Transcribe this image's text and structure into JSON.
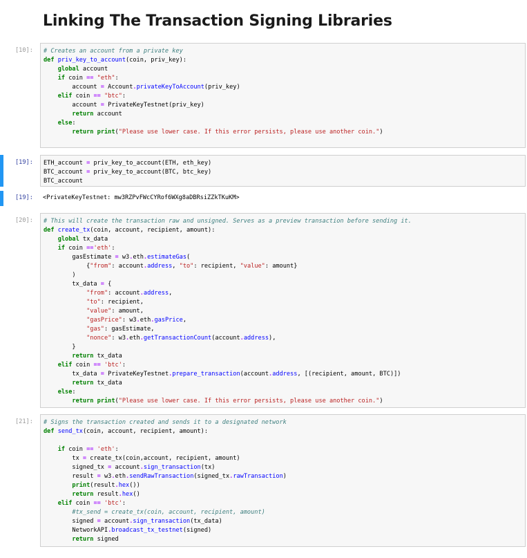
{
  "notebook": {
    "heading": "Linking The Transaction Signing Libraries",
    "cells": [
      {
        "prompt": "[10]:",
        "lines": [
          [
            [
              "c",
              "# Creates an account from a private key"
            ]
          ],
          [
            [
              "k",
              "def"
            ],
            [
              "n",
              " "
            ],
            [
              "f",
              "priv_key_to_account"
            ],
            [
              "n",
              "(coin, priv_key):"
            ]
          ],
          [
            [
              "n",
              "    "
            ],
            [
              "k",
              "global"
            ],
            [
              "n",
              " account"
            ]
          ],
          [
            [
              "n",
              "    "
            ],
            [
              "k",
              "if"
            ],
            [
              "n",
              " coin "
            ],
            [
              "o",
              "=="
            ],
            [
              "n",
              " "
            ],
            [
              "s",
              "\"eth\""
            ],
            [
              "n",
              ":"
            ]
          ],
          [
            [
              "n",
              "        account "
            ],
            [
              "o",
              "="
            ],
            [
              "n",
              " Account"
            ],
            [
              "o",
              "."
            ],
            [
              "f",
              "privateKeyToAccount"
            ],
            [
              "n",
              "(priv_key)"
            ]
          ],
          [
            [
              "n",
              "    "
            ],
            [
              "k",
              "elif"
            ],
            [
              "n",
              " coin "
            ],
            [
              "o",
              "=="
            ],
            [
              "n",
              " "
            ],
            [
              "s",
              "\"btc\""
            ],
            [
              "n",
              ":"
            ]
          ],
          [
            [
              "n",
              "        account "
            ],
            [
              "o",
              "="
            ],
            [
              "n",
              " PrivateKeyTestnet(priv_key)"
            ]
          ],
          [
            [
              "n",
              "        "
            ],
            [
              "k",
              "return"
            ],
            [
              "n",
              " account"
            ]
          ],
          [
            [
              "n",
              "    "
            ],
            [
              "k",
              "else"
            ],
            [
              "n",
              ":"
            ]
          ],
          [
            [
              "n",
              "        "
            ],
            [
              "k",
              "return"
            ],
            [
              "n",
              " "
            ],
            [
              "k",
              "print"
            ],
            [
              "n",
              "("
            ],
            [
              "s",
              "\"Please use lower case. If this error persists, please use another coin.\""
            ],
            [
              "n",
              ")"
            ]
          ],
          [
            [
              "n",
              " "
            ]
          ]
        ]
      },
      {
        "prompt": "[19]:",
        "lines": [
          [
            [
              "n",
              "ETH_account "
            ],
            [
              "o",
              "="
            ],
            [
              "n",
              " priv_key_to_account(ETH, eth_key)"
            ]
          ],
          [
            [
              "n",
              "BTC_account "
            ],
            [
              "o",
              "="
            ],
            [
              "n",
              " priv_key_to_account(BTC, btc_key)"
            ]
          ],
          [
            [
              "n",
              "BTC_account"
            ]
          ]
        ]
      },
      {
        "prompt": "[20]:",
        "lines": [
          [
            [
              "c",
              "# This will create the transaction raw and unsigned. Serves as a preview transaction before sending it."
            ]
          ],
          [
            [
              "k",
              "def"
            ],
            [
              "n",
              " "
            ],
            [
              "f",
              "create_tx"
            ],
            [
              "n",
              "(coin, account, recipient, amount):"
            ]
          ],
          [
            [
              "n",
              "    "
            ],
            [
              "k",
              "global"
            ],
            [
              "n",
              " tx_data"
            ]
          ],
          [
            [
              "n",
              "    "
            ],
            [
              "k",
              "if"
            ],
            [
              "n",
              " coin "
            ],
            [
              "o",
              "=="
            ],
            [
              "s",
              "'eth'"
            ],
            [
              "n",
              ":"
            ]
          ],
          [
            [
              "n",
              "        gasEstimate "
            ],
            [
              "o",
              "="
            ],
            [
              "n",
              " w3"
            ],
            [
              "o",
              "."
            ],
            [
              "n",
              "eth"
            ],
            [
              "o",
              "."
            ],
            [
              "f",
              "estimateGas"
            ],
            [
              "n",
              "("
            ]
          ],
          [
            [
              "n",
              "            {"
            ],
            [
              "s",
              "\"from\""
            ],
            [
              "n",
              ": account"
            ],
            [
              "o",
              "."
            ],
            [
              "f",
              "address"
            ],
            [
              "n",
              ", "
            ],
            [
              "s",
              "\"to\""
            ],
            [
              "n",
              ": recipient, "
            ],
            [
              "s",
              "\"value\""
            ],
            [
              "n",
              ": amount}"
            ]
          ],
          [
            [
              "n",
              "        )"
            ]
          ],
          [
            [
              "n",
              "        tx_data "
            ],
            [
              "o",
              "="
            ],
            [
              "n",
              " {"
            ]
          ],
          [
            [
              "n",
              "            "
            ],
            [
              "s",
              "\"from\""
            ],
            [
              "n",
              ": account"
            ],
            [
              "o",
              "."
            ],
            [
              "f",
              "address"
            ],
            [
              "n",
              ","
            ]
          ],
          [
            [
              "n",
              "            "
            ],
            [
              "s",
              "\"to\""
            ],
            [
              "n",
              ": recipient,"
            ]
          ],
          [
            [
              "n",
              "            "
            ],
            [
              "s",
              "\"value\""
            ],
            [
              "n",
              ": amount,"
            ]
          ],
          [
            [
              "n",
              "            "
            ],
            [
              "s",
              "\"gasPrice\""
            ],
            [
              "n",
              ": w3"
            ],
            [
              "o",
              "."
            ],
            [
              "n",
              "eth"
            ],
            [
              "o",
              "."
            ],
            [
              "f",
              "gasPrice"
            ],
            [
              "n",
              ","
            ]
          ],
          [
            [
              "n",
              "            "
            ],
            [
              "s",
              "\"gas\""
            ],
            [
              "n",
              ": gasEstimate,"
            ]
          ],
          [
            [
              "n",
              "            "
            ],
            [
              "s",
              "\"nonce\""
            ],
            [
              "n",
              ": w3"
            ],
            [
              "o",
              "."
            ],
            [
              "n",
              "eth"
            ],
            [
              "o",
              "."
            ],
            [
              "f",
              "getTransactionCount"
            ],
            [
              "n",
              "(account"
            ],
            [
              "o",
              "."
            ],
            [
              "f",
              "address"
            ],
            [
              "n",
              "),"
            ]
          ],
          [
            [
              "n",
              "        }"
            ]
          ],
          [
            [
              "n",
              "        "
            ],
            [
              "k",
              "return"
            ],
            [
              "n",
              " tx_data"
            ]
          ],
          [
            [
              "n",
              "    "
            ],
            [
              "k",
              "elif"
            ],
            [
              "n",
              " coin "
            ],
            [
              "o",
              "=="
            ],
            [
              "n",
              " "
            ],
            [
              "s",
              "'btc'"
            ],
            [
              "n",
              ":"
            ]
          ],
          [
            [
              "n",
              "        tx_data "
            ],
            [
              "o",
              "="
            ],
            [
              "n",
              " PrivateKeyTestnet"
            ],
            [
              "o",
              "."
            ],
            [
              "f",
              "prepare_transaction"
            ],
            [
              "n",
              "(account"
            ],
            [
              "o",
              "."
            ],
            [
              "f",
              "address"
            ],
            [
              "n",
              ", [(recipient, amount, BTC)])"
            ]
          ],
          [
            [
              "n",
              "        "
            ],
            [
              "k",
              "return"
            ],
            [
              "n",
              " tx_data"
            ]
          ],
          [
            [
              "n",
              "    "
            ],
            [
              "k",
              "else"
            ],
            [
              "n",
              ":"
            ]
          ],
          [
            [
              "n",
              "        "
            ],
            [
              "k",
              "return"
            ],
            [
              "n",
              " "
            ],
            [
              "k",
              "print"
            ],
            [
              "n",
              "("
            ],
            [
              "s",
              "\"Please use lower case. If this error persists, please use another coin.\""
            ],
            [
              "n",
              ")"
            ]
          ]
        ]
      },
      {
        "prompt": "[21]:",
        "lines": [
          [
            [
              "c",
              "# Signs the transaction created and sends it to a designated network"
            ]
          ],
          [
            [
              "k",
              "def"
            ],
            [
              "n",
              " "
            ],
            [
              "f",
              "send_tx"
            ],
            [
              "n",
              "(coin, account, recipient, amount):"
            ]
          ],
          [
            [
              "n",
              " "
            ]
          ],
          [
            [
              "n",
              "    "
            ],
            [
              "k",
              "if"
            ],
            [
              "n",
              " coin "
            ],
            [
              "o",
              "=="
            ],
            [
              "n",
              " "
            ],
            [
              "s",
              "'eth'"
            ],
            [
              "n",
              ":"
            ]
          ],
          [
            [
              "n",
              "        tx "
            ],
            [
              "o",
              "="
            ],
            [
              "n",
              " create_tx(coin,account, recipient, amount)"
            ]
          ],
          [
            [
              "n",
              "        signed_tx "
            ],
            [
              "o",
              "="
            ],
            [
              "n",
              " account"
            ],
            [
              "o",
              "."
            ],
            [
              "f",
              "sign_transaction"
            ],
            [
              "n",
              "(tx)"
            ]
          ],
          [
            [
              "n",
              "        result "
            ],
            [
              "o",
              "="
            ],
            [
              "n",
              " w3"
            ],
            [
              "o",
              "."
            ],
            [
              "n",
              "eth"
            ],
            [
              "o",
              "."
            ],
            [
              "f",
              "sendRawTransaction"
            ],
            [
              "n",
              "(signed_tx"
            ],
            [
              "o",
              "."
            ],
            [
              "f",
              "rawTransaction"
            ],
            [
              "n",
              ")"
            ]
          ],
          [
            [
              "n",
              "        "
            ],
            [
              "k",
              "print"
            ],
            [
              "n",
              "(result"
            ],
            [
              "o",
              "."
            ],
            [
              "f",
              "hex"
            ],
            [
              "n",
              "())"
            ]
          ],
          [
            [
              "n",
              "        "
            ],
            [
              "k",
              "return"
            ],
            [
              "n",
              " result"
            ],
            [
              "o",
              "."
            ],
            [
              "f",
              "hex"
            ],
            [
              "n",
              "()"
            ]
          ],
          [
            [
              "n",
              "    "
            ],
            [
              "k",
              "elif"
            ],
            [
              "n",
              " coin "
            ],
            [
              "o",
              "=="
            ],
            [
              "n",
              " "
            ],
            [
              "s",
              "'btc'"
            ],
            [
              "n",
              ":"
            ]
          ],
          [
            [
              "n",
              "        "
            ],
            [
              "c",
              "#tx_send = create_tx(coin, account, recipient, amount)"
            ]
          ],
          [
            [
              "n",
              "        signed "
            ],
            [
              "o",
              "="
            ],
            [
              "n",
              " account"
            ],
            [
              "o",
              "."
            ],
            [
              "f",
              "sign_transaction"
            ],
            [
              "n",
              "(tx_data)"
            ]
          ],
          [
            [
              "n",
              "        NetworkAPI"
            ],
            [
              "o",
              "."
            ],
            [
              "f",
              "broadcast_tx_testnet"
            ],
            [
              "n",
              "(signed)"
            ]
          ],
          [
            [
              "n",
              "        "
            ],
            [
              "k",
              "return"
            ],
            [
              "n",
              " signed"
            ]
          ]
        ]
      }
    ],
    "output": {
      "prompt": "[19]:",
      "text": "<PrivateKeyTestnet: mw3RZPvFWcCYRof6WXg8aDBRsiZZkTKuKM>"
    }
  }
}
